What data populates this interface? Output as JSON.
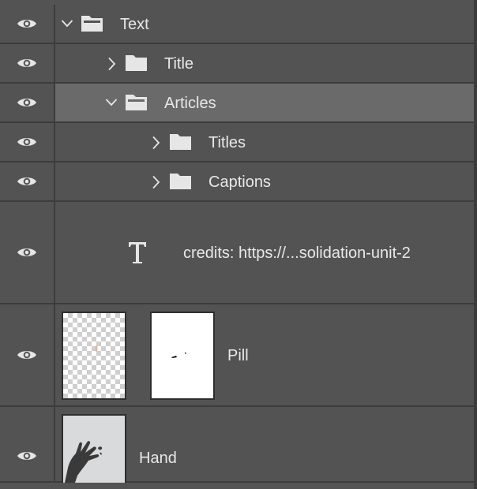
{
  "layers": [
    {
      "name": "Text",
      "type": "group",
      "expanded": true
    },
    {
      "name": "Title",
      "type": "group",
      "expanded": false
    },
    {
      "name": "Articles",
      "type": "group",
      "expanded": true,
      "selected": true
    },
    {
      "name": "Titles",
      "type": "group",
      "expanded": false
    },
    {
      "name": "Captions",
      "type": "group",
      "expanded": false
    },
    {
      "name": "credits: https://...solidation-unit-2",
      "type": "text",
      "icon": "type-tool-icon"
    },
    {
      "name": "Pill",
      "type": "image-with-mask"
    },
    {
      "name": "Hand",
      "type": "image"
    }
  ],
  "colors": {
    "panel_bg": "#535353",
    "selected_bg": "#6a6a6a",
    "divider": "#3c3c3c",
    "text": "#e8e8e8"
  },
  "icons": {
    "visibility": "eye-icon",
    "group": "folder-icon",
    "expand": "chevron-icon",
    "text_layer": "type-tool-icon"
  }
}
